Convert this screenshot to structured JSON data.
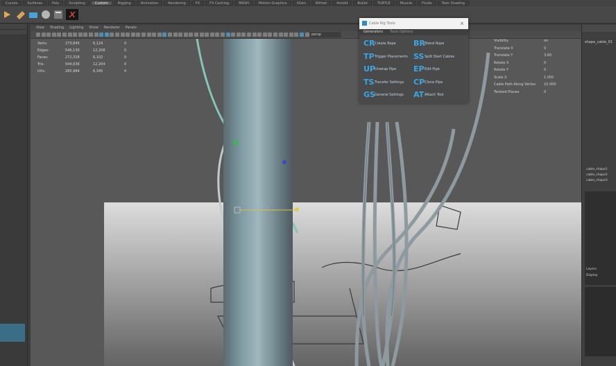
{
  "shelf": {
    "tabs": [
      {
        "label": "Curves",
        "active": false
      },
      {
        "label": "Surfaces",
        "active": false
      },
      {
        "label": "Poly",
        "active": false
      },
      {
        "label": "Sculpting",
        "active": false
      },
      {
        "label": "Custom",
        "active": true
      },
      {
        "label": "Rigging",
        "active": false
      },
      {
        "label": "Animation",
        "active": false
      },
      {
        "label": "Rendering",
        "active": false
      },
      {
        "label": "FX",
        "active": false
      },
      {
        "label": "FX Caching",
        "active": false
      },
      {
        "label": "MASH",
        "active": false
      },
      {
        "label": "Motion Graphics",
        "active": false
      },
      {
        "label": "XGen",
        "active": false
      },
      {
        "label": "Bifrost",
        "active": false
      },
      {
        "label": "Arnold",
        "active": false
      },
      {
        "label": "Bullet",
        "active": false
      },
      {
        "label": "TURTLE",
        "active": false
      },
      {
        "label": "Muscle",
        "active": false
      },
      {
        "label": "Fluids",
        "active": false
      },
      {
        "label": "Toon Shading",
        "active": false
      }
    ]
  },
  "panel": {
    "menu": [
      "View",
      "Shading",
      "Lighting",
      "Show",
      "Renderer",
      "Panels"
    ],
    "camera_field": "persp"
  },
  "hud": {
    "rows": [
      {
        "label": "Verts:",
        "v1": "273,845",
        "v2": "6,124",
        "v3": "0"
      },
      {
        "label": "Edges:",
        "v1": "546,130",
        "v2": "12,208",
        "v3": "0"
      },
      {
        "label": "Faces:",
        "v1": "272,318",
        "v2": "6,102",
        "v3": "0"
      },
      {
        "label": "Tris:",
        "v1": "544,636",
        "v2": "12,204",
        "v3": "0"
      },
      {
        "label": "UVs:",
        "v1": "285,964",
        "v2": "6,345",
        "v3": "0"
      }
    ]
  },
  "script_window": {
    "title": "Cable Rig Tools",
    "close": "×",
    "tabs": [
      {
        "label": "Generators",
        "active": true
      },
      {
        "label": "Tools Options",
        "active": false
      }
    ],
    "tools": [
      {
        "icon": "CR",
        "label": "Create Rope",
        "icon_name": "create-rope-icon"
      },
      {
        "icon": "BR",
        "label": "Blend Rope",
        "icon_name": "blend-rope-icon"
      },
      {
        "icon": "TP",
        "label": "Trigger Placements",
        "icon_name": "trigger-placements-icon"
      },
      {
        "icon": "SS",
        "label": "Split Start Cables",
        "icon_name": "split-cables-icon"
      },
      {
        "icon": "UP",
        "label": "Unwrap Pipe",
        "icon_name": "unwrap-pipe-icon"
      },
      {
        "icon": "EP",
        "label": "Edit Pipe",
        "icon_name": "edit-pipe-icon"
      },
      {
        "icon": "TS",
        "label": "Transfer Settings",
        "icon_name": "transfer-settings-icon"
      },
      {
        "icon": "CP",
        "label": "Clone Pipe",
        "icon_name": "clone-pipe-icon"
      },
      {
        "icon": "GS",
        "label": "General Settings",
        "icon_name": "general-settings-icon"
      },
      {
        "icon": "AT",
        "label": "Attach Tool",
        "icon_name": "attach-tool-icon"
      }
    ]
  },
  "channel_box": {
    "rows": [
      {
        "k": "Visibility",
        "v": "on"
      },
      {
        "k": "Translate X",
        "v": "0"
      },
      {
        "k": "Translate Y",
        "v": "3.60"
      },
      {
        "k": "Rotate X",
        "v": "0"
      },
      {
        "k": "Rotate Y",
        "v": "0"
      },
      {
        "k": "Scale X",
        "v": "1.050"
      },
      {
        "k": "Cable Path Along Vertex",
        "v": "10.000"
      },
      {
        "k": "Twisted Planes",
        "v": "0"
      }
    ]
  },
  "right_panel": {
    "name": "shape_cable_01",
    "shapes": [
      "cable_shape1",
      "cable_shape2",
      "cable_shape3"
    ],
    "lower": [
      "Layers",
      "Display"
    ]
  }
}
